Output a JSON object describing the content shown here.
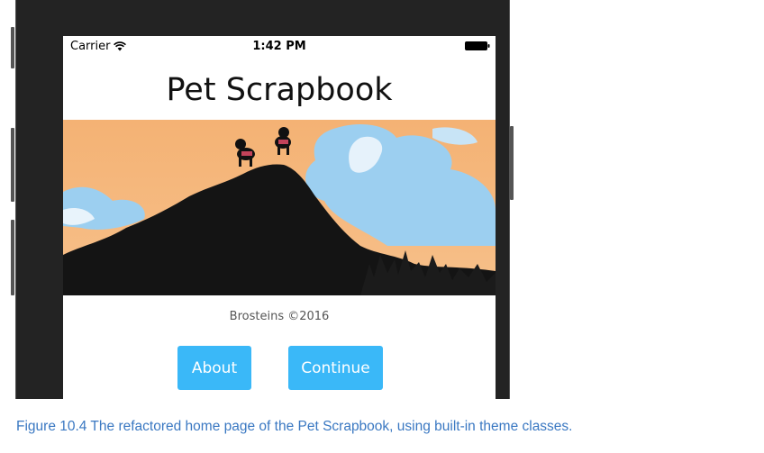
{
  "status_bar": {
    "carrier": "Carrier",
    "time": "1:42 PM",
    "wifi_icon": "wifi-icon",
    "battery_icon": "battery-icon"
  },
  "app": {
    "title": "Pet Scrapbook",
    "hero_image": "two dogs on a cliff silhouette at sunset",
    "copyright": "Brosteins ©2016"
  },
  "buttons": {
    "about": "About",
    "continue": "Continue"
  },
  "colors": {
    "button_bg": "#3ab8f8",
    "caption": "#3a78c2",
    "sky": "#f6b679",
    "cloud": "#9fd3f0"
  },
  "caption": "Figure 10.4 The refactored home page of the Pet Scrapbook, using built-in theme classes."
}
